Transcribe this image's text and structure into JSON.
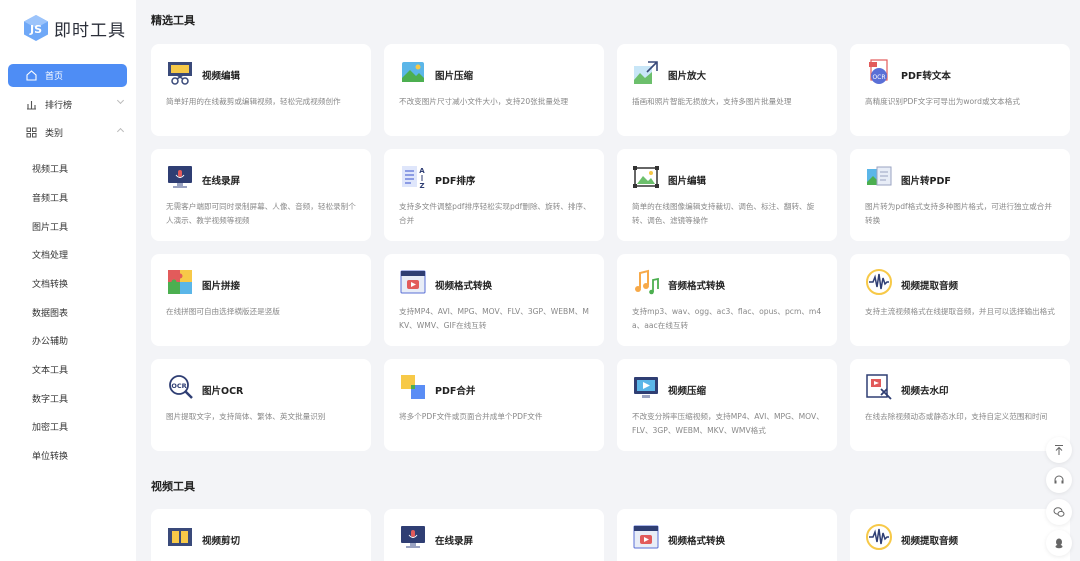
{
  "brand": {
    "name": "即时工具",
    "accent": "#4e8df5"
  },
  "nav": {
    "home": "首页",
    "ranking": "排行榜",
    "categories": "类别",
    "sub_items": [
      "视频工具",
      "音频工具",
      "图片工具",
      "文档处理",
      "文档转换",
      "数据图表",
      "办公辅助",
      "文本工具",
      "数字工具",
      "加密工具",
      "单位转换"
    ]
  },
  "sections": {
    "featured": "精选工具",
    "video": "视频工具"
  },
  "featured_cards": [
    {
      "title": "视频编辑",
      "desc": "简单好用的在线裁剪或编辑视频，轻松完成视频创作",
      "icon": "film-scissors-icon"
    },
    {
      "title": "图片压缩",
      "desc": "不改变图片尺寸减小文件大小，支持20张批量处理",
      "icon": "image-compress-icon"
    },
    {
      "title": "图片放大",
      "desc": "插画和照片智能无损放大，支持多图片批量处理",
      "icon": "image-enlarge-icon"
    },
    {
      "title": "PDF转文本",
      "desc": "高精度识别PDF文字可导出为word或文本格式",
      "icon": "pdf-ocr-icon"
    },
    {
      "title": "在线录屏",
      "desc": "无需客户端即可同时录制屏幕、人像、音频，轻松录制个人演示、教学视频等视频",
      "icon": "screen-record-icon"
    },
    {
      "title": "PDF排序",
      "desc": "支持多文件调整pdf排序轻松实现pdf删除、旋转、排序、合并",
      "icon": "pdf-sort-icon"
    },
    {
      "title": "图片编辑",
      "desc": "简单的在线图像编辑支持裁切、调色、标注、翻转、旋转、调色、滤镜等操作",
      "icon": "image-edit-icon"
    },
    {
      "title": "图片转PDF",
      "desc": "图片转为pdf格式支持多种图片格式，可进行独立或合并转换",
      "icon": "image-to-pdf-icon"
    },
    {
      "title": "图片拼接",
      "desc": "在线拼图可自由选择横版还是竖版",
      "icon": "puzzle-icon"
    },
    {
      "title": "视频格式转换",
      "desc": "支持MP4、AVI、MPG、MOV、FLV、3GP、WEBM、MKV、WMV、GIF在线互转",
      "icon": "video-convert-icon"
    },
    {
      "title": "音频格式转换",
      "desc": "支持mp3、wav、ogg、ac3、flac、opus、pcm、m4a、aac在线互转",
      "icon": "music-note-icon"
    },
    {
      "title": "视频提取音频",
      "desc": "支持主流视频格式在线提取音频，并且可以选择输出格式",
      "icon": "waveform-icon"
    },
    {
      "title": "图片OCR",
      "desc": "图片提取文字，支持简体、繁体、英文批量识别",
      "icon": "ocr-icon"
    },
    {
      "title": "PDF合并",
      "desc": "将多个PDF文件或页面合并成单个PDF文件",
      "icon": "pdf-merge-icon"
    },
    {
      "title": "视频压缩",
      "desc": "不改变分辨率压缩视频，支持MP4、AVI、MPG、MOV、FLV、3GP、WEBM、MKV、WMV格式",
      "icon": "video-compress-icon"
    },
    {
      "title": "视频去水印",
      "desc": "在线去除视频动态或静态水印，支持自定义范围和时间",
      "icon": "watermark-remove-icon"
    }
  ],
  "video_cards": [
    {
      "title": "视频剪切",
      "icon": "film-cut-icon"
    },
    {
      "title": "在线录屏",
      "icon": "screen-record-icon"
    },
    {
      "title": "视频格式转换",
      "icon": "video-convert-icon"
    },
    {
      "title": "视频提取音频",
      "icon": "waveform-icon"
    }
  ],
  "float_buttons": [
    "back-to-top-icon",
    "headset-icon",
    "wechat-icon",
    "qq-icon"
  ]
}
